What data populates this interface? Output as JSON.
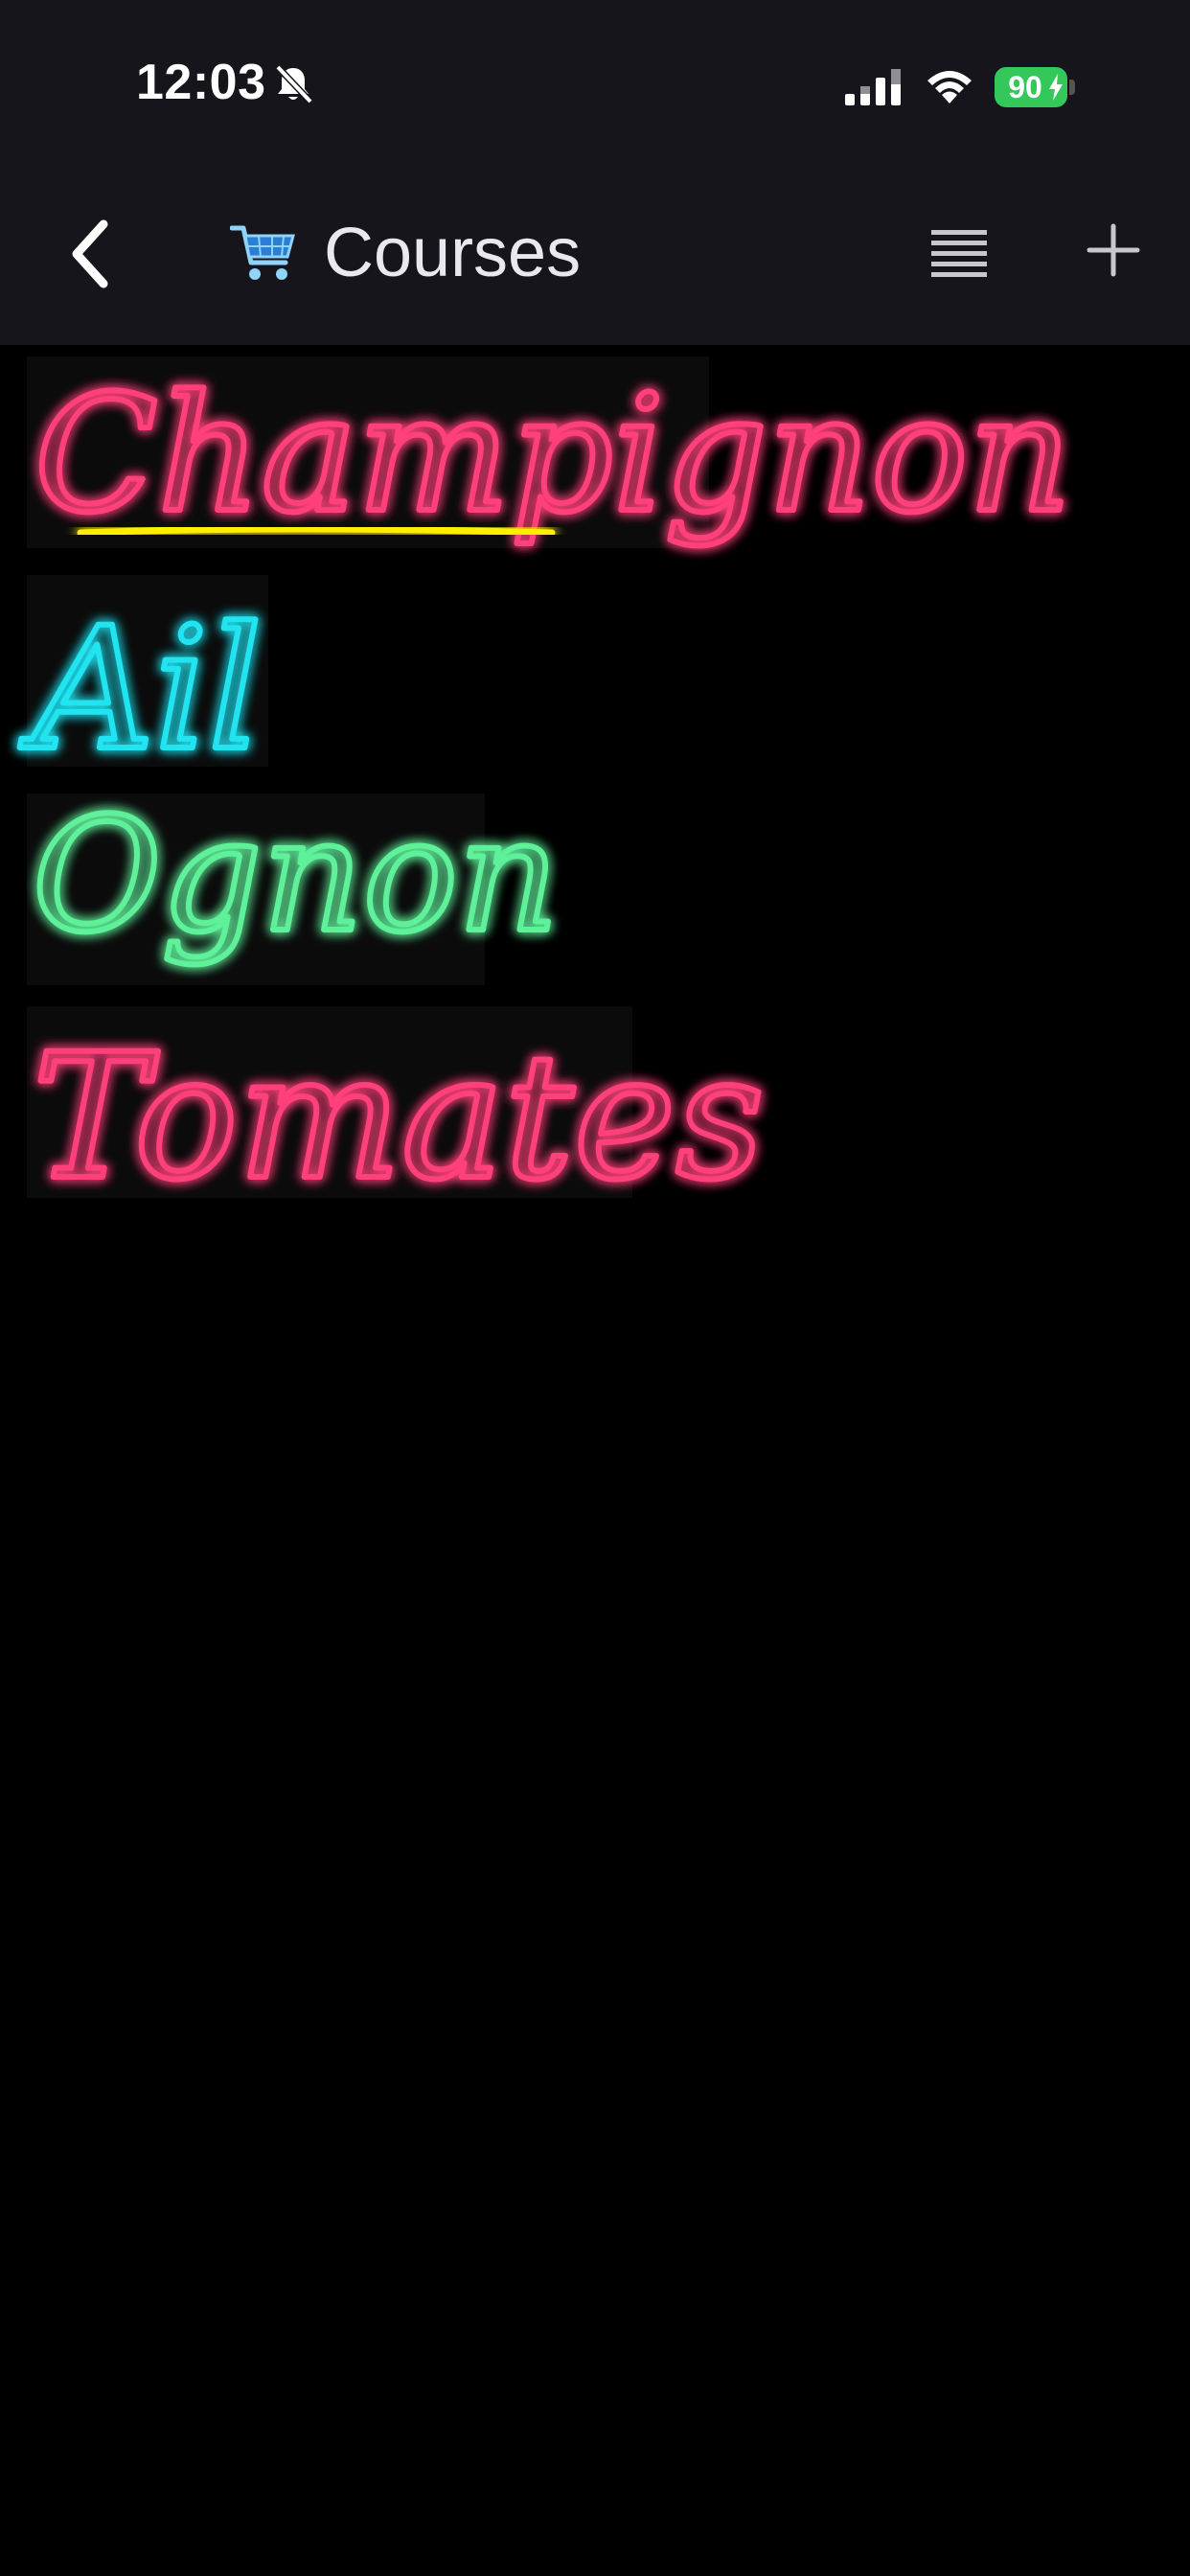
{
  "status_bar": {
    "time": "12:03",
    "battery_level": "90"
  },
  "nav": {
    "title": "Courses",
    "icons": {
      "back": "chevron-left-icon",
      "cart": "shopping-cart-icon",
      "list": "list-lines-icon",
      "add": "plus-icon"
    }
  },
  "items": [
    {
      "text": "Champignon",
      "color": "#ff3f7a",
      "underline_color": "#ffee00"
    },
    {
      "text": "Ail",
      "color": "#22e3f0"
    },
    {
      "text": "Ognon",
      "color": "#5ef09a"
    },
    {
      "text": "Tomates",
      "color": "#ff3f7a"
    }
  ],
  "colors": {
    "background": "#000000",
    "bar_background": "#16151c",
    "battery": "#34c759"
  }
}
